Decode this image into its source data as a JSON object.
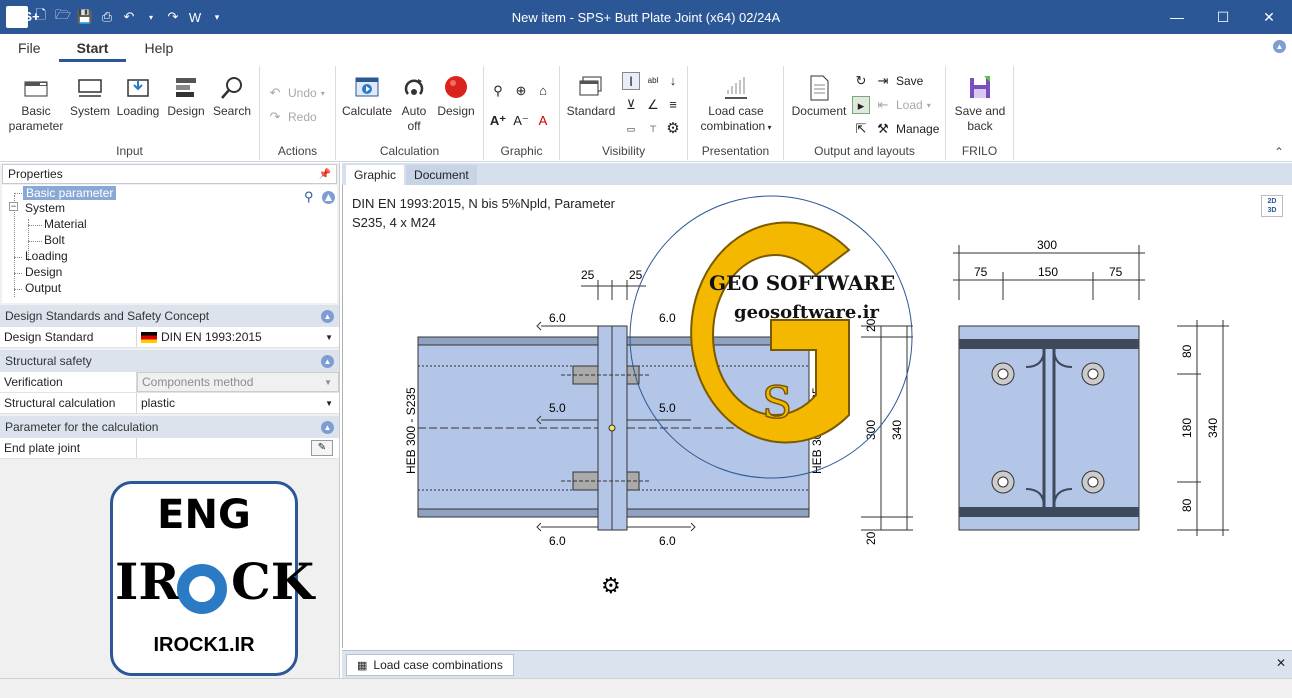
{
  "window": {
    "title": "New item - SPS+ Butt Plate Joint (x64) 02/24A",
    "app_logo": "SPS+",
    "qat_word_label": "W",
    "controls": {
      "minimize": "—",
      "maximize": "☐",
      "close": "✕"
    }
  },
  "menu": {
    "tabs": [
      {
        "label": "File"
      },
      {
        "label": "Start"
      },
      {
        "label": "Help"
      }
    ]
  },
  "ribbon": {
    "input": {
      "label": "Input",
      "basic_parameter": "Basic parameter",
      "system": "System",
      "loading": "Loading",
      "design": "Design",
      "search": "Search"
    },
    "actions": {
      "label": "Actions",
      "undo": "Undo",
      "redo": "Redo"
    },
    "calculation": {
      "label": "Calculation",
      "calculate": "Calculate",
      "auto_off": "Auto off",
      "design": "Design"
    },
    "graphic": {
      "label": "Graphic"
    },
    "visibility": {
      "label": "Visibility",
      "standard": "Standard"
    },
    "presentation": {
      "label": "Presentation",
      "load_case_combination": "Load case combination"
    },
    "output": {
      "label": "Output and layouts",
      "document": "Document",
      "save": "Save",
      "load": "Load",
      "manage": "Manage"
    },
    "frilo": {
      "label": "FRILO",
      "save_and_back": "Save and back"
    }
  },
  "left_panel": {
    "header": "Properties",
    "tree": {
      "basic_parameter": "Basic parameter",
      "system": "System",
      "material": "Material",
      "bolt": "Bolt",
      "loading": "Loading",
      "design": "Design",
      "output": "Output"
    },
    "sections": {
      "design_standards": {
        "title": "Design Standards and Safety Concept",
        "design_standard_key": "Design Standard",
        "design_standard_value": "DIN EN 1993:2015"
      },
      "structural_safety": {
        "title": "Structural safety",
        "verification_key": "Verification",
        "verification_value": "Components method",
        "structural_calc_key": "Structural calculation",
        "structural_calc_value": "plastic"
      },
      "parameter_calc": {
        "title": "Parameter for the calculation",
        "end_plate_key": "End plate joint"
      }
    }
  },
  "doc_tabs": [
    {
      "label": "Graphic"
    },
    {
      "label": "Document"
    }
  ],
  "canvas": {
    "line1": "DIN EN 1993:2015,  N bis 5%Npld,  Parameter",
    "line2": "S235,  4 x M24",
    "view_toggle_2d": "2D",
    "view_toggle_3d": "3D",
    "dims": {
      "d25a": "25",
      "d25b": "25",
      "w60_tl": "6.0",
      "w60_tr": "6.0",
      "w50_l": "5.0",
      "w50_r": "5.0",
      "w60_bl": "6.0",
      "w60_br": "6.0",
      "heb_left": "HEB 300 - S235",
      "heb_right": "HEB 300 - S235",
      "v20_top": "20",
      "v300": "300",
      "v340": "340",
      "v20_bot": "20",
      "top300": "300",
      "top75a": "75",
      "top150": "150",
      "top75b": "75",
      "r80a": "80",
      "r180": "180",
      "r80b": "80",
      "r340": "340"
    },
    "watermark_geo_title": "GEO SOFTWARE",
    "watermark_geo_url": "geosoftware.ir",
    "watermark_geo_letters": "S"
  },
  "watermark_eng": {
    "line1": "ENG",
    "line2_left": "IR",
    "line2_right": "CK",
    "line3": "IROCK1.IR"
  },
  "bottom": {
    "tab_label": "Load case combinations",
    "close": "✕"
  },
  "colors": {
    "accent": "#2b5797",
    "steel": "#b4c6e7",
    "steel_dark": "#2f3a4a",
    "gold": "#f5b800"
  }
}
